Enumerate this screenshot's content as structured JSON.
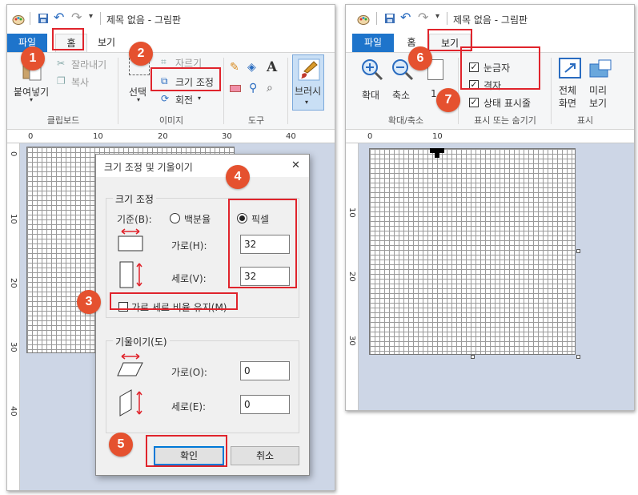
{
  "left_window": {
    "title": "제목 없음 - 그림판",
    "tabs": [
      "파일",
      "홈",
      "보기"
    ],
    "ribbon": {
      "paste": "붙여넣기",
      "cut": "잘라내기",
      "copy": "복사",
      "clipboard_group": "클립보드",
      "select": "선택",
      "crop": "자르기",
      "resize": "크기 조정",
      "rotate": "회전",
      "image_group": "이미지",
      "tools_group": "도구",
      "text_tool": "A",
      "brush": "브러시"
    },
    "ruler_h": [
      "0",
      "10",
      "20",
      "30",
      "40"
    ],
    "ruler_v": [
      "0",
      "10",
      "20",
      "30",
      "40"
    ],
    "dialog": {
      "title": "크기 조정 및 기울이기",
      "close": "✕",
      "resize_group": "크기 조정",
      "basis_label": "기준(B):",
      "percent": "백분율",
      "pixel": "픽셀",
      "horizontal": "가로(H):",
      "vertical": "세로(V):",
      "horizontal_value": "32",
      "vertical_value": "32",
      "keep_ratio": "가로 세로 비율 유지(M)",
      "skew_group": "기울이기(도)",
      "skew_horizontal": "가로(O):",
      "skew_vertical": "세로(E):",
      "skew_horizontal_value": "0",
      "skew_vertical_value": "0",
      "ok": "확인",
      "cancel": "취소"
    }
  },
  "right_window": {
    "title": "제목 없음 - 그림판",
    "tabs": [
      "파일",
      "홈",
      "보기"
    ],
    "ribbon": {
      "zoom_in": "확대",
      "zoom_out": "축소",
      "hundred": "1",
      "zoom_group": "확대/축소",
      "ruler": "눈금자",
      "gridlines": "격자",
      "statusbar": "상태 표시줄",
      "showhide_group": "표시 또는 숨기기",
      "fullscreen_1": "전체",
      "fullscreen_2": "화면",
      "thumbnail_1": "미리",
      "thumbnail_2": "보기",
      "display_group": "표시"
    },
    "ruler_h": [
      "0",
      "10"
    ],
    "ruler_v": [
      "10",
      "20",
      "30"
    ]
  },
  "badges": [
    "1",
    "2",
    "3",
    "4",
    "5",
    "6",
    "7"
  ],
  "colors": {
    "file_tab": "#1e74cb",
    "highlight": "#e0242c",
    "badge": "#e5512f",
    "canvas_bg": "#cdd6e6"
  }
}
